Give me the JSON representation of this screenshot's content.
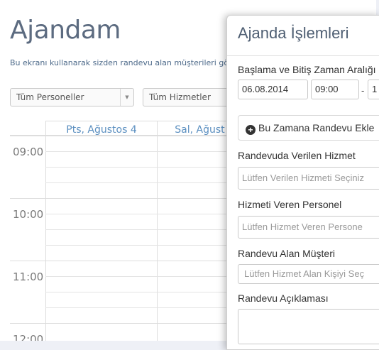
{
  "page": {
    "title": "Ajandam",
    "description": "Bu ekranı kullanarak sizden randevu alan müşterileri gör"
  },
  "filters": {
    "staff_select": "Tüm Personeller",
    "service_select": "Tüm Hizmetler"
  },
  "calendar": {
    "days": [
      "Pts, Ağustos 4",
      "Sal, Ağust"
    ],
    "times": [
      "09:00",
      "10:00",
      "11:00",
      "12:00"
    ]
  },
  "panel": {
    "title": "Ajanda İşlemleri",
    "range_label": "Başlama ve Bitiş Zaman Aralığı",
    "start_date": "06.08.2014",
    "start_time": "09:00",
    "dash": "-",
    "end_partial": "1",
    "add_button": "Bu Zamana Randevu Ekle",
    "service_label": "Randevuda Verilen Hizmet",
    "service_placeholder": "Lütfen Verilen Hizmeti Seçiniz",
    "staff_label": "Hizmeti Veren Personel",
    "staff_placeholder": "Lütfen Hizmet Veren Persone",
    "customer_label": "Randevu Alan Müşteri",
    "customer_placeholder": "Lütfen Hizmet Alan Kişiyi Seç",
    "note_label": "Randevu Açıklaması"
  },
  "icons": {
    "add": "plus-circle-icon",
    "caret": "chevron-down-icon"
  }
}
